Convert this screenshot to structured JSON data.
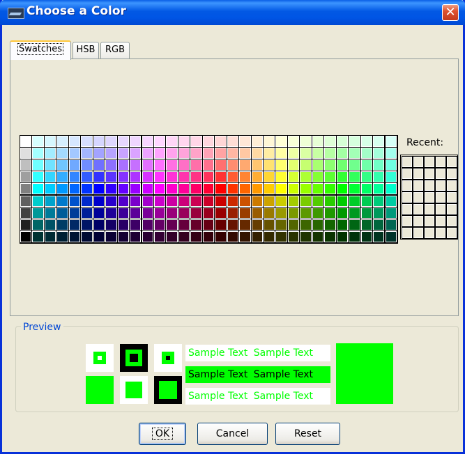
{
  "window": {
    "title": "Choose a Color",
    "close_glyph": "✕"
  },
  "tabs": [
    {
      "label": "Swatches",
      "active": true
    },
    {
      "label": "HSB",
      "active": false
    },
    {
      "label": "RGB",
      "active": false
    }
  ],
  "swatches": {
    "recent_label": "Recent:"
  },
  "preview": {
    "legend": "Preview",
    "sample_text": "Sample Text",
    "selected_color": "#00FF00",
    "sample_rows": [
      [
        "Sample Text",
        "Sample Text"
      ],
      [
        "Sample Text",
        "Sample Text"
      ],
      [
        "Sample Text",
        "Sample Text"
      ]
    ]
  },
  "buttons": {
    "ok": "OK",
    "cancel": "Cancel",
    "reset": "Reset"
  },
  "colors": {
    "accent": "#0046D5",
    "title_bar": "#0058E5",
    "background": "#ECE9D8"
  }
}
